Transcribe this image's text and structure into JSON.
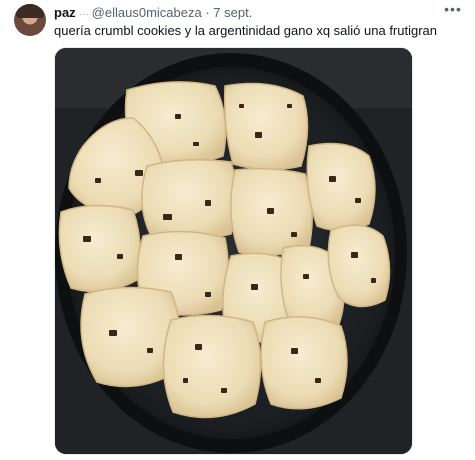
{
  "tweet": {
    "author_name": "paz",
    "verified_mark": "···",
    "handle": "@ellaus0micabeza",
    "separator": "·",
    "date": "7 sept.",
    "text": "quería crumbl cookies y la argentinidad gano xq salió una frutigran",
    "more_icon": "more-horizontal-icon"
  },
  "colors": {
    "text_primary": "#0f1419",
    "text_secondary": "#536471",
    "media_bg": "#1e2124",
    "cookie": "#f1e4c3"
  }
}
